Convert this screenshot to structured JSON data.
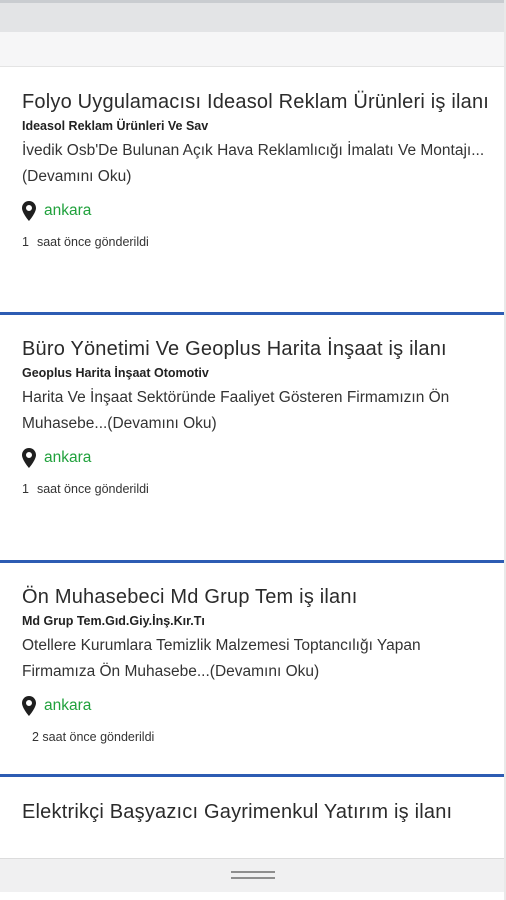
{
  "listings": [
    {
      "title": "Folyo Uygulamacısı Ideasol Reklam Ürünleri iş ilanı",
      "company": "Ideasol Reklam Ürünleri Ve Sav",
      "summary": "İvedik Osb'De Bulunan Açık Hava Reklamlıcığı İmalatı Ve Montajı...(Devamını Oku)",
      "location": "ankara",
      "posted_count": "1",
      "posted_text": "saat önce gönderildi"
    },
    {
      "title": "Büro Yönetimi Ve Geoplus Harita İnşaat iş ilanı",
      "company": "Geoplus Harita İnşaat Otomotiv",
      "summary": "Harita Ve İnşaat Sektöründe Faaliyet Gösteren Firmamızın Ön Muhasebe...(Devamını Oku)",
      "location": "ankara",
      "posted_count": "1",
      "posted_text": "saat önce gönderildi"
    },
    {
      "title": "Ön Muhasebeci Md Grup Tem iş ilanı",
      "company": "Md Grup Tem.Gıd.Giy.İnş.Kır.Tı",
      "summary": "Otellere Kurumlara Temizlik Malzemesi Toptancılığı Yapan Firmamıza Ön Muhasebe...(Devamını Oku)",
      "location": "ankara",
      "posted_count": "",
      "posted_text": "2 saat önce gönderildi"
    },
    {
      "title": "Elektrikçi Başyazıcı Gayrimenkul Yatırım iş ilanı"
    }
  ],
  "icons": {
    "location": "map-pin-icon",
    "handle": "drag-handle-icon"
  },
  "colors": {
    "separator": "#2d5cb3",
    "location_text": "#20a13c",
    "title_text": "#2b2b2b"
  }
}
